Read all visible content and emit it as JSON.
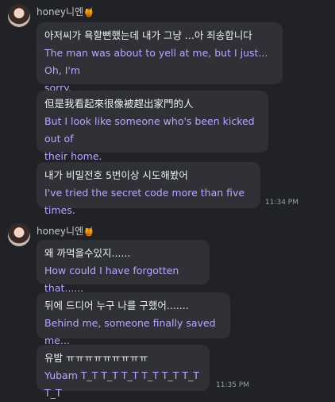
{
  "group1": {
    "username": "honey니엔",
    "badge": "🍯",
    "messages": [
      {
        "ko": "아저씨가 욕할뻔했는데 내가 그냥 ...아 죄송합니다",
        "en": "The man was about to yell at me, but I just... Oh, I'm\nsorry."
      },
      {
        "ko": "但是我看起來很像被趕出家門的人",
        "en": "But I look like someone who's been kicked out of\ntheir home."
      },
      {
        "ko": "내가 비밀전호 5번이상 시도해봤어",
        "en": "I've tried the secret code more than five times."
      }
    ],
    "timestamp": "11:34 PM"
  },
  "group2": {
    "username": "honey니엔",
    "badge": "🍯",
    "messages": [
      {
        "ko": "왜 까먹을수있지......",
        "en": "How could I have forgotten that......"
      },
      {
        "ko": "뒤에 드디어 누구 나를 구했어.......",
        "en": "Behind me, someone finally saved me..."
      },
      {
        "ko": "유밤 ㅠㅠㅠㅠㅠㅠㅠㅠㅠ",
        "en": "Yubam T_T T_T T_T T_T T_T T_T T_T"
      }
    ],
    "timestamp": "11:35 PM"
  }
}
